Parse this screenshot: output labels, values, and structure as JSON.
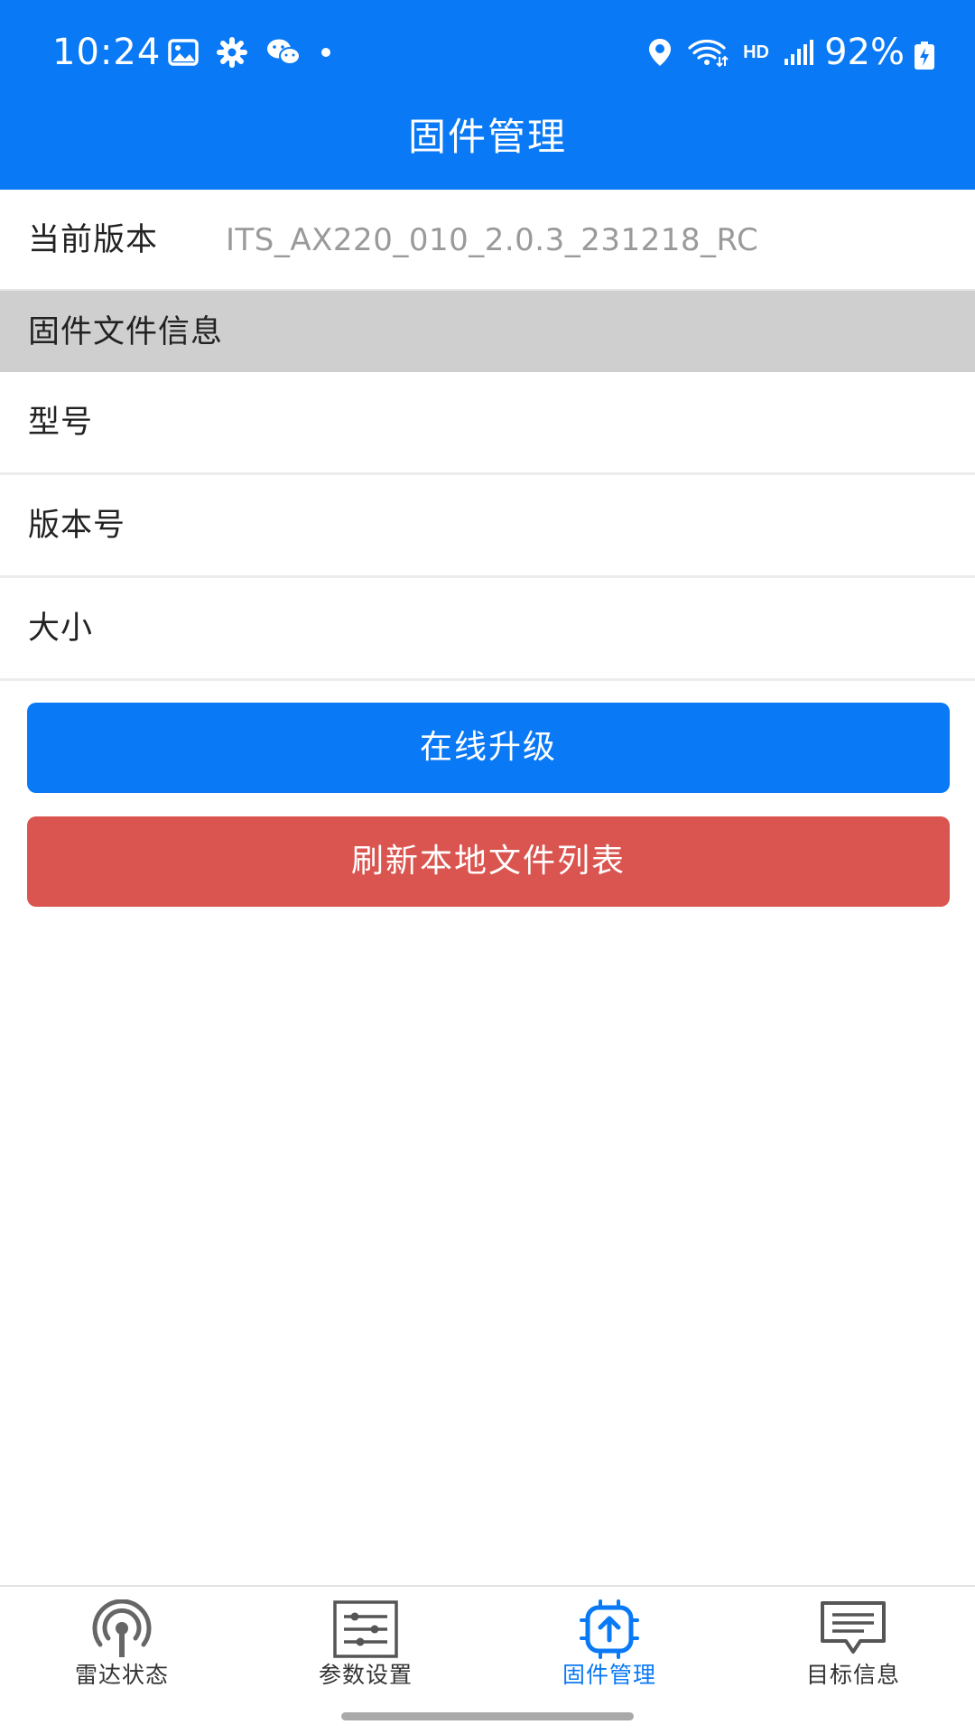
{
  "status_bar": {
    "time": "10:24",
    "battery": "92%",
    "network_label": "HD"
  },
  "header": {
    "title": "固件管理"
  },
  "current_version": {
    "label": "当前版本",
    "value": "ITS_AX220_010_2.0.3_231218_RC"
  },
  "firmware_info": {
    "section_title": "固件文件信息",
    "rows": [
      {
        "label": "型号"
      },
      {
        "label": "版本号"
      },
      {
        "label": "大小"
      }
    ]
  },
  "actions": {
    "upgrade_label": "在线升级",
    "refresh_label": "刷新本地文件列表"
  },
  "bottom_nav": {
    "items": [
      {
        "label": "雷达状态",
        "icon": "radar-icon",
        "active": false
      },
      {
        "label": "参数设置",
        "icon": "sliders-icon",
        "active": false
      },
      {
        "label": "固件管理",
        "icon": "chip-upload-icon",
        "active": true
      },
      {
        "label": "目标信息",
        "icon": "message-icon",
        "active": false
      }
    ]
  },
  "colors": {
    "primary": "#0a79f5",
    "danger": "#da5550",
    "section_bg": "#cfcfcf",
    "value_text": "#9a9a9a"
  }
}
